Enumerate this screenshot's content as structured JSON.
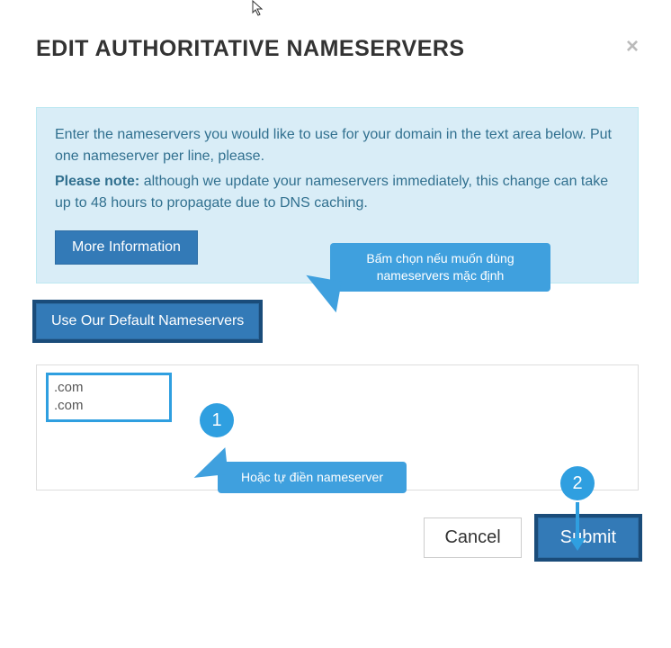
{
  "modal": {
    "title": "EDIT AUTHORITATIVE NAMESERVERS",
    "close_glyph": "×"
  },
  "notice": {
    "line1": "Enter the nameservers you would like to use for your domain in the text area below. Put one nameserver per line, please.",
    "note_label": "Please note:",
    "line2_rest": " although we update your nameservers immediately, this change can take up to 48 hours to propagate due to DNS caching.",
    "more_info_btn": "More Information"
  },
  "default_ns_btn": "Use Our Default Nameservers",
  "nameservers_value": ".com\n.com",
  "actions": {
    "cancel": "Cancel",
    "submit": "Submit"
  },
  "callouts": {
    "c1": "Bấm chọn nếu muốn dùng nameservers mặc định",
    "c2": "Hoặc tự điền nameserver"
  },
  "badges": {
    "b1": "1",
    "b2": "2"
  },
  "colors": {
    "callout_bg": "#3fa0de",
    "primary": "#337ab7",
    "highlight_outline": "#1a4c7a",
    "notice_bg": "#d9edf7",
    "notice_text": "#31708f"
  }
}
